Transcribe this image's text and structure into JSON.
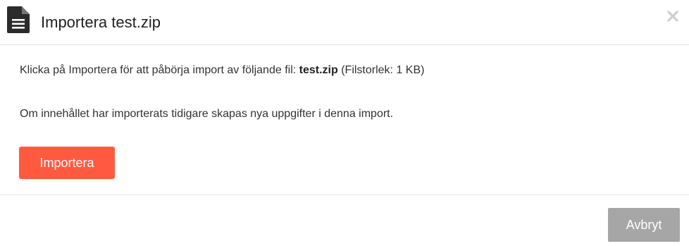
{
  "header": {
    "icon": "document-icon",
    "title": "Importera test.zip",
    "close_icon": "close-icon"
  },
  "body": {
    "line1_prefix": "Klicka på Importera för att påbörja import av följande fil: ",
    "file_name": "test.zip",
    "line1_suffix": " (Filstorlek: 1 KB)",
    "line2": "Om innehållet har importerats tidigare skapas nya uppgifter i denna import.",
    "import_button_label": "Importera"
  },
  "footer": {
    "cancel_button_label": "Avbryt"
  },
  "colors": {
    "import_button": "#ff5a40",
    "cancel_button": "#a6a6a6",
    "divider": "#e5e5e5"
  }
}
